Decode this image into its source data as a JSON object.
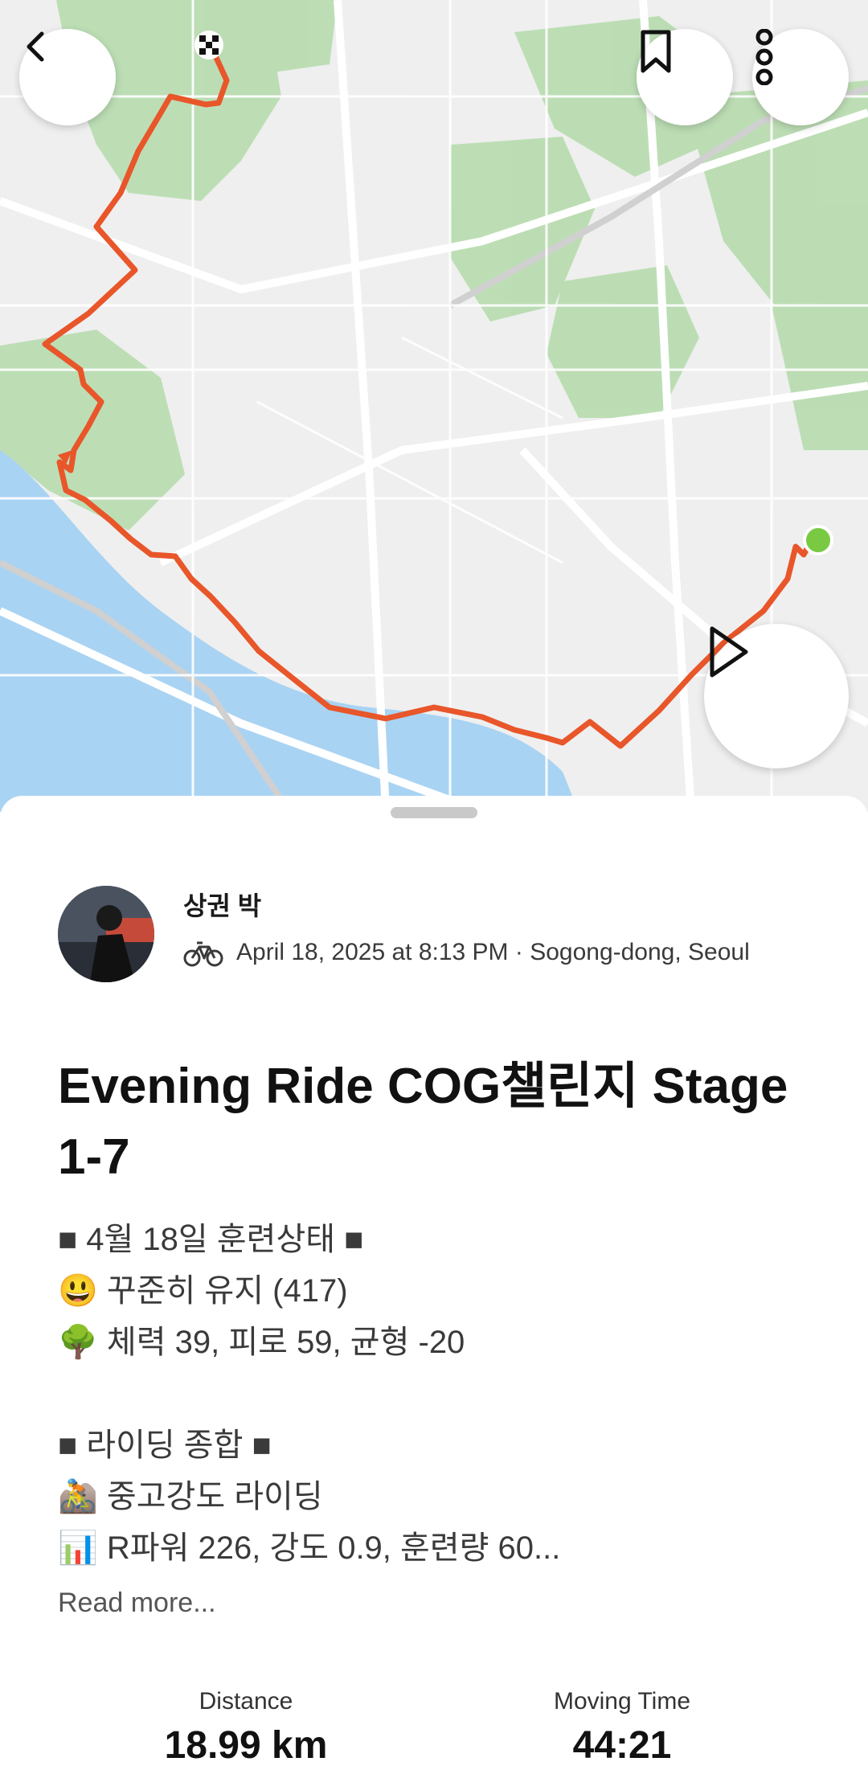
{
  "map": {
    "route_color": "#e8562a",
    "start_color": "#7ac943",
    "water_color": "#a9d3f3",
    "park_color": "#b7dcae"
  },
  "athlete": {
    "name": "상권 박",
    "activity_icon": "bike-icon",
    "meta": "April 18, 2025 at 8:13 PM · Sogong-dong, Seoul"
  },
  "activity": {
    "title": "Evening Ride COG챌린지 Stage 1-7",
    "description": [
      "■ 4월 18일 훈련상태 ■",
      "😃 꾸준히 유지 (417)",
      "🌳 체력 39, 피로 59, 균형 -20",
      "",
      "■ 라이딩 종합 ■",
      "🚵 중고강도 라이딩",
      "📊 R파워 226, 강도 0.9, 훈련량 60..."
    ],
    "read_more": "Read more..."
  },
  "stats": [
    {
      "label": "Distance",
      "value": "18.99 km"
    },
    {
      "label": "Moving Time",
      "value": "44:21"
    }
  ]
}
